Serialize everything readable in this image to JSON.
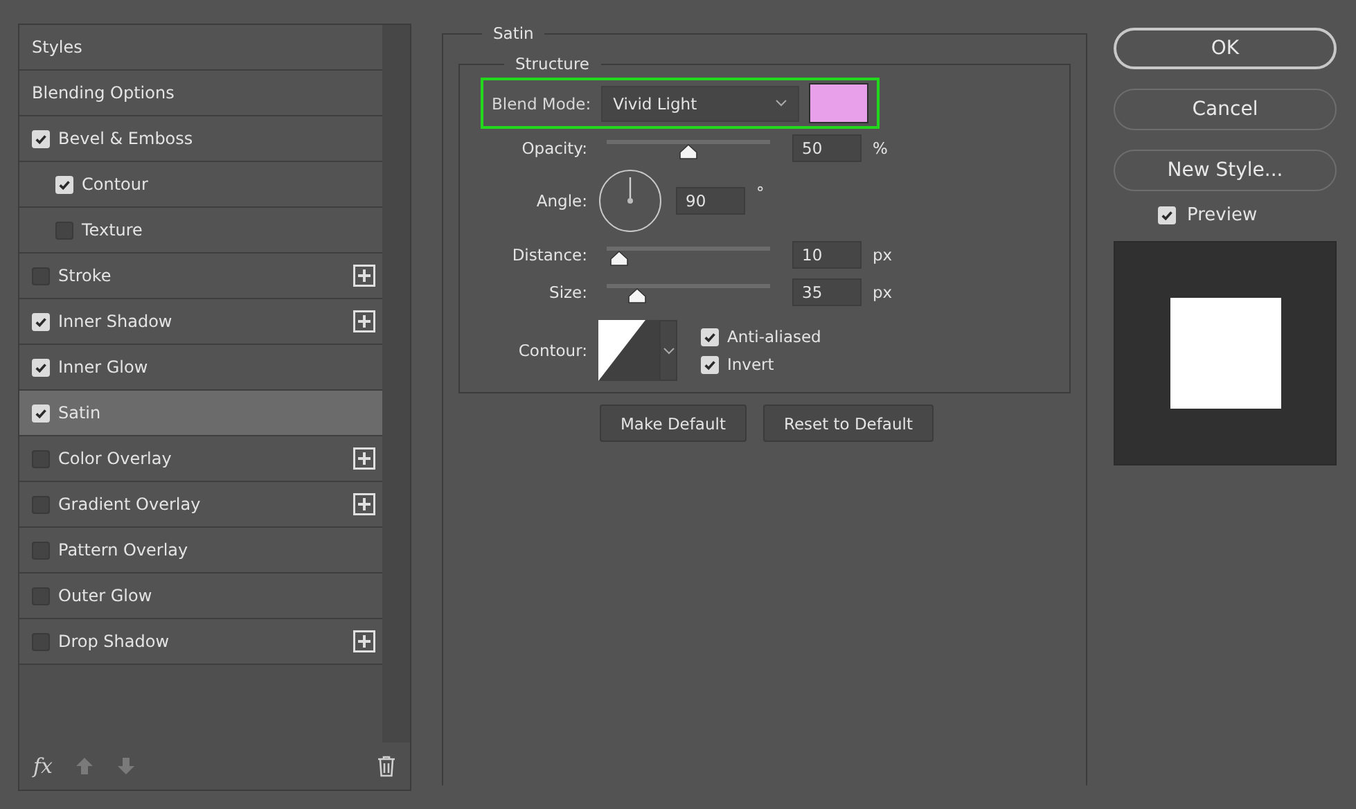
{
  "sidebar": {
    "items": [
      {
        "label": "Styles",
        "kind": "header",
        "selected": false
      },
      {
        "label": "Blending Options",
        "kind": "header",
        "selected": false
      },
      {
        "label": "Bevel & Emboss",
        "kind": "check",
        "checked": true,
        "selected": false,
        "addable": false,
        "children": [
          {
            "label": "Contour",
            "kind": "check",
            "checked": true,
            "selected": false,
            "addable": false
          },
          {
            "label": "Texture",
            "kind": "check",
            "checked": false,
            "selected": false,
            "addable": false
          }
        ]
      },
      {
        "label": "Stroke",
        "kind": "check",
        "checked": false,
        "selected": false,
        "addable": true
      },
      {
        "label": "Inner Shadow",
        "kind": "check",
        "checked": true,
        "selected": false,
        "addable": true
      },
      {
        "label": "Inner Glow",
        "kind": "check",
        "checked": true,
        "selected": false,
        "addable": false
      },
      {
        "label": "Satin",
        "kind": "check",
        "checked": true,
        "selected": true,
        "addable": false
      },
      {
        "label": "Color Overlay",
        "kind": "check",
        "checked": false,
        "selected": false,
        "addable": true
      },
      {
        "label": "Gradient Overlay",
        "kind": "check",
        "checked": false,
        "selected": false,
        "addable": true
      },
      {
        "label": "Pattern Overlay",
        "kind": "check",
        "checked": false,
        "selected": false,
        "addable": false
      },
      {
        "label": "Outer Glow",
        "kind": "check",
        "checked": false,
        "selected": false,
        "addable": false
      },
      {
        "label": "Drop Shadow",
        "kind": "check",
        "checked": false,
        "selected": false,
        "addable": true
      }
    ],
    "toolbar": {
      "fx_label": "fx"
    }
  },
  "panel": {
    "title": "Satin",
    "group": "Structure",
    "blend_mode": {
      "label": "Blend Mode:",
      "value": "Vivid Light",
      "color": "#e8a0ea",
      "highlighted": true
    },
    "sliders": [
      {
        "kind": "slider",
        "label": "Opacity:",
        "level": 0.5,
        "value": "50",
        "unit": "%"
      },
      {
        "kind": "angle",
        "label": "Angle:",
        "value": "90",
        "unit": "°"
      },
      {
        "kind": "slider",
        "label": "Distance:",
        "level": 0.08,
        "value": "10",
        "unit": "px"
      },
      {
        "kind": "slider",
        "label": "Size:",
        "level": 0.19,
        "value": "35",
        "unit": "px"
      }
    ],
    "contour": {
      "label": "Contour:",
      "options": [
        {
          "label": "Anti-aliased",
          "checked": true
        },
        {
          "label": "Invert",
          "checked": true
        }
      ]
    },
    "buttons": [
      "Make Default",
      "Reset to Default"
    ]
  },
  "actions": {
    "buttons": [
      "OK",
      "Cancel",
      "New Style..."
    ],
    "preview": {
      "label": "Preview",
      "checked": true
    }
  }
}
